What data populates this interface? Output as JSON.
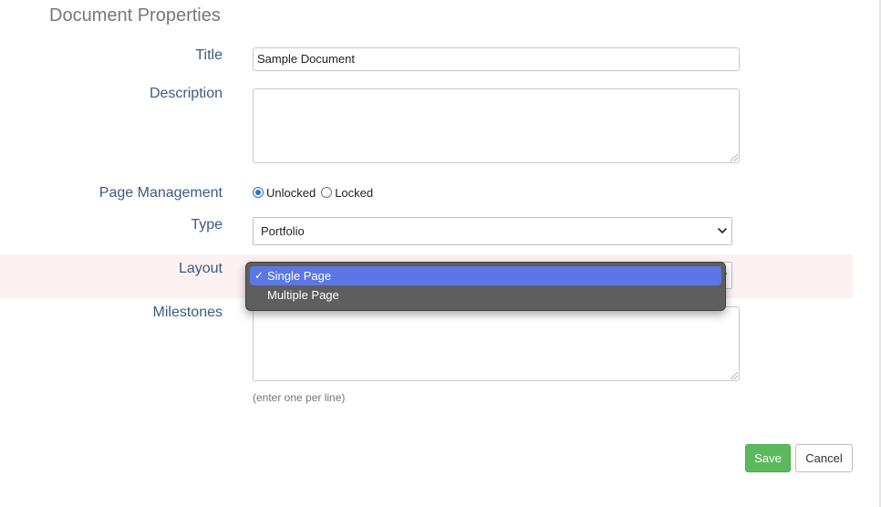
{
  "heading": "Document Properties",
  "fields": {
    "title": {
      "label": "Title",
      "value": "Sample Document"
    },
    "description": {
      "label": "Description",
      "value": ""
    },
    "page_management": {
      "label": "Page Management",
      "options": [
        "Unlocked",
        "Locked"
      ],
      "selected": "Unlocked"
    },
    "type": {
      "label": "Type",
      "value": "Portfolio"
    },
    "layout": {
      "label": "Layout",
      "options": [
        "Single Page",
        "Multiple Page"
      ],
      "selected": "Single Page",
      "check_glyph": "✓"
    },
    "milestones": {
      "label": "Milestones",
      "value": "",
      "hint": "(enter one per line)"
    }
  },
  "buttons": {
    "save": "Save",
    "cancel": "Cancel"
  },
  "colors": {
    "save": "#5cb85c",
    "label": "#3b5b80",
    "highlight_row": "#fdf1f1",
    "dropdown_bg": "#5e5e5e",
    "dropdown_selected": "#5b77e6"
  },
  "icons": {
    "select_arrow": "chevron-down-icon",
    "resize": "resize-grip-icon",
    "check": "checkmark-icon"
  }
}
